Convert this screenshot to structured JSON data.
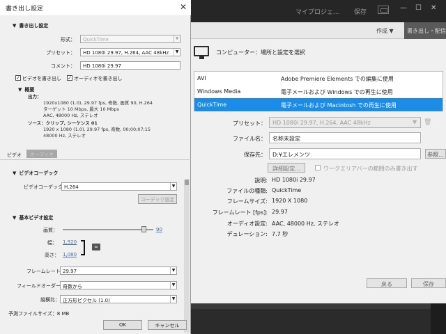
{
  "app": {
    "project_title": "マイプロジェ...",
    "save_label": "保存",
    "tab_create": "作成 ▼",
    "tab_export": "書き出し・配信",
    "destination_label": "コンピューター：場所と設定を選択",
    "formats": [
      {
        "name": "AVI",
        "desc": "Adobe Premiere Elements での編集に使用"
      },
      {
        "name": "Windows Media",
        "desc": "電子メールおよび Windows での再生に使用"
      },
      {
        "name": "QuickTime",
        "desc": "電子メールおよび Macintosh での再生に使用"
      }
    ],
    "preset_label": "プリセット：",
    "preset_value": "HD 1080i 29.97, H.264, AAC 48kHz",
    "filename_label": "ファイル名：",
    "filename_value": "名称未設定",
    "saveto_label": "保存先：",
    "saveto_value": "D:¥エレメンツ",
    "browse_label": "参照...",
    "advanced_label": "詳細設定...",
    "workarea_label": "ワークエリアバーの範囲のみ書き出す",
    "info": [
      {
        "k": "説明:",
        "v": "HD 1080i 29.97"
      },
      {
        "k": "ファイルの種類:",
        "v": "QuickTime"
      },
      {
        "k": "フレームサイズ:",
        "v": "1920 X 1080"
      },
      {
        "k": "フレームレート [fps]:",
        "v": "29.97"
      },
      {
        "k": "オーディオ設定:",
        "v": "AAC, 48000 Hz, ステレオ"
      },
      {
        "k": "デュレーション:",
        "v": "7.7 秒"
      }
    ],
    "back_label": "戻る",
    "save_btn_label": "保存"
  },
  "dialog": {
    "title": "書き出し設定",
    "export_settings_title": "書き出し設定",
    "format_label": "形式：",
    "format_value": "QuickTime",
    "preset_label": "プリセット：",
    "preset_value": "HD 1080i 29.97, H.264, AAC 48kHz",
    "comment_label": "コメント：",
    "comment_value": "HD 1080i 29.97",
    "export_video_label": "ビデオを書き出し",
    "export_audio_label": "オーディオを書き出し",
    "summary_title": "概要",
    "output_label": "出力：",
    "output_lines": [
      "1920x1080 (1.0), 29.97 fps, 奇数, 画質 90, H.264",
      "ターゲット 10 Mbps, 最大 10 Mbps",
      "AAC, 48000 Hz, ステレオ"
    ],
    "source_label": "ソース：クリップ, シーケンス 01",
    "source_lines": [
      "1920 x 1080 (1.0), 29.97 fps, 奇数, 00;00;07;15",
      "48000 Hz, ステレオ"
    ],
    "tab_video": "ビデオ",
    "tab_audio": "オーディオ",
    "video_codec_title": "ビデオコーデック",
    "video_codec_label": "ビデオコーデック：",
    "video_codec_value": "H.264",
    "codec_settings_label": "コーデック設定",
    "basic_video_title": "基本ビデオ設定",
    "quality_label": "画質：",
    "quality_value": "90",
    "quality_level": 0.9,
    "width_label": "幅：",
    "width_value": "1,920",
    "height_label": "高さ：",
    "height_value": "1,080",
    "framerate_label": "フレームレート：",
    "framerate_value": "29.97",
    "field_order_label": "フィールドオーダー：",
    "field_order_value": "奇数から",
    "aspect_label": "縦横比：",
    "aspect_value": "正方形ピクセル (1.0)",
    "estimated_size": "予測ファイルサイズ：8 MB",
    "ok_label": "OK",
    "cancel_label": "キャンセル"
  }
}
